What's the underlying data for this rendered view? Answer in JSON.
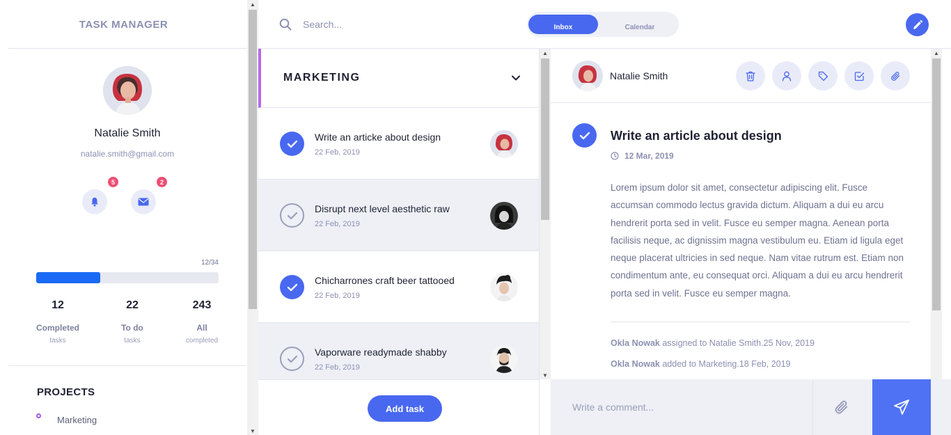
{
  "sidebar": {
    "brand": "TASK MANAGER",
    "profile": {
      "name": "Natalie Smith",
      "email": "natalie.smith@gmail.com",
      "notifications_count": "5",
      "messages_count": "2"
    },
    "progress": {
      "label": "12/34",
      "completed": 12,
      "total": 34
    },
    "stats": [
      {
        "value": "12",
        "label": "Completed",
        "sub": "tasks"
      },
      {
        "value": "22",
        "label": "To do",
        "sub": "tasks"
      },
      {
        "value": "243",
        "label": "All",
        "sub": "completed"
      }
    ],
    "projects_title": "PROJECTS",
    "projects": [
      {
        "name": "Marketing",
        "color": "#a259e6"
      }
    ]
  },
  "topbar": {
    "search_placeholder": "Search...",
    "tabs": [
      {
        "label": "Inbox",
        "active": true
      },
      {
        "label": "Calendar",
        "active": false
      }
    ]
  },
  "tasklist": {
    "title": "MARKETING",
    "tasks": [
      {
        "title": "Write an articke about design",
        "date": "22 Feb, 2019",
        "done": true
      },
      {
        "title": "Disrupt next level aesthetic raw",
        "date": "22 Feb, 2019",
        "done": false
      },
      {
        "title": "Chicharrones craft beer tattooed",
        "date": "22 Feb, 2019",
        "done": true
      },
      {
        "title": "Vaporware readymade shabby",
        "date": "22 Feb, 2019",
        "done": false
      }
    ],
    "add_task_label": "Add task"
  },
  "detail": {
    "user_name": "Natalie Smith",
    "title": "Write an article about design",
    "date": "12 Mar, 2019",
    "body": "Lorem ipsum dolor sit amet, consectetur adipiscing elit. Fusce accumsan commodo lectus gravida dictum. Aliquam a dui eu arcu hendrerit porta sed in velit. Fusce eu semper magna. Aenean porta facilisis neque, ac dignissim magna vestibulum eu. Etiam id ligula eget neque placerat ultricies in sed neque. Nam vitae rutrum est. Etiam non condimentum ante, eu consequat orci. Aliquam a dui eu arcu hendrerit porta sed in velit. Fusce eu semper magna.",
    "activity": [
      {
        "actor": "Okla Nowak",
        "text": " assigned to Natalie Smith.25 Nov, 2019"
      },
      {
        "actor": "Okla Nowak",
        "text": " added to Marketing.18 Feb, 2019"
      }
    ]
  },
  "comment": {
    "placeholder": "Write a comment..."
  },
  "colors": {
    "accent": "#4968f0",
    "badge": "#ee4f74",
    "progress": "#1a6af5",
    "project": "#a259e6"
  }
}
